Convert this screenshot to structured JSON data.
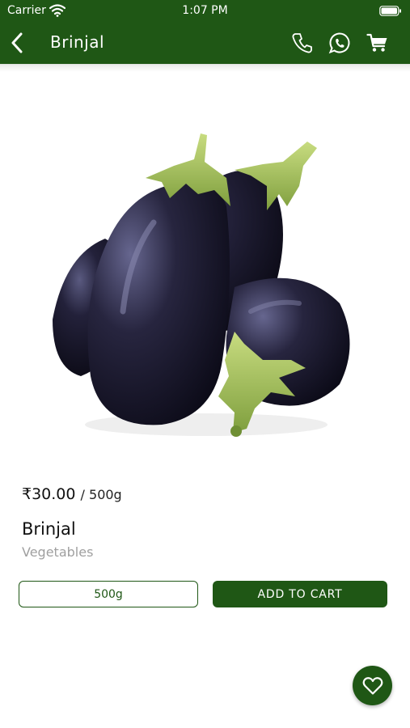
{
  "status_bar": {
    "carrier": "Carrier",
    "time": "1:07 PM"
  },
  "header": {
    "title": "Brinjal"
  },
  "product": {
    "price": "₹30.00",
    "unit": "/ 500g",
    "name": "Brinjal",
    "category": "Vegetables",
    "selected_weight": "500g"
  },
  "actions": {
    "add_to_cart": "ADD TO CART"
  },
  "colors": {
    "brand": "#1f5715",
    "muted_text": "#a0a0a0"
  },
  "icons": [
    "back-arrow-icon",
    "phone-icon",
    "whatsapp-icon",
    "cart-icon",
    "heart-icon"
  ]
}
